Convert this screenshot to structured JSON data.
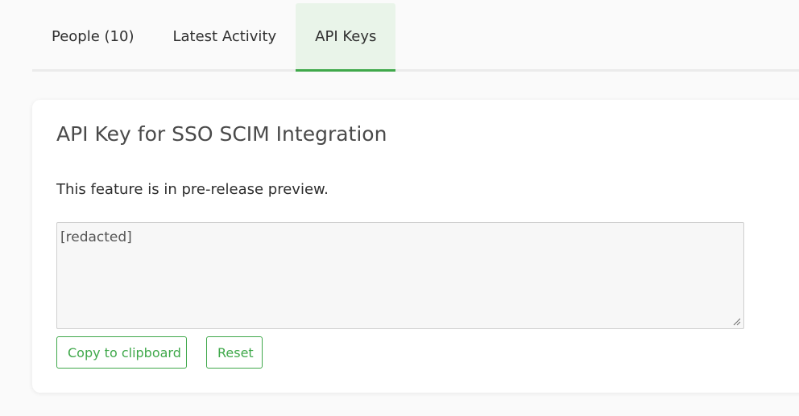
{
  "tabs": [
    {
      "label": "People (10)"
    },
    {
      "label": "Latest Activity"
    },
    {
      "label": "API Keys",
      "active": true
    }
  ],
  "card": {
    "title": "API Key for SSO SCIM Integration",
    "description": "This feature is in pre-release preview.",
    "key_value": "[redacted]",
    "copy_label": "Copy to clipboard",
    "reset_label": "Reset"
  },
  "colors": {
    "accent": "#3fa84a",
    "active_tab_bg": "#e9f4e9"
  }
}
